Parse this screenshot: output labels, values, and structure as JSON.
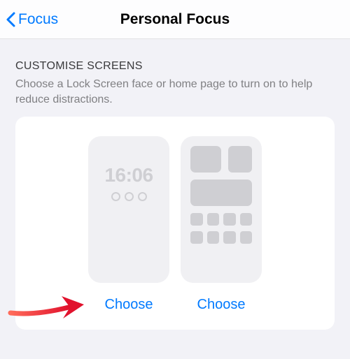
{
  "nav": {
    "back_label": "Focus",
    "title": "Personal Focus"
  },
  "section": {
    "header": "CUSTOMISE SCREENS",
    "description": "Choose a Lock Screen face or home page to turn on to help reduce distractions."
  },
  "lockscreen_preview": {
    "time": "16:06",
    "choose_label": "Choose"
  },
  "homescreen_preview": {
    "choose_label": "Choose"
  }
}
